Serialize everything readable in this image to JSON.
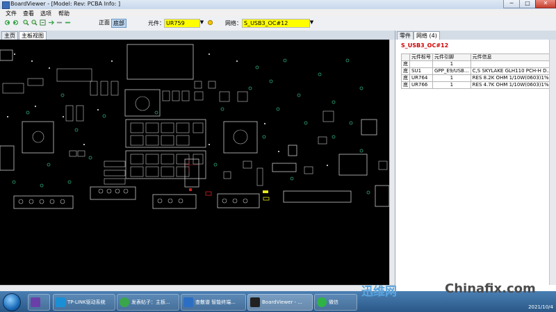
{
  "window": {
    "title": "BoardViewer  -  [Model: Rev:  PCBA Info: ]",
    "min_label": "─",
    "max_label": "□",
    "close_label": "✕"
  },
  "menu": [
    "文件",
    "查看",
    "选项",
    "帮助"
  ],
  "toolbar": {
    "view_front_label": "正面",
    "view_back_label": "底部",
    "component_label": "元件：",
    "component_value": "UR759",
    "net_label": "网络：",
    "net_value": "S_USB3_OC#12",
    "dropdown_arrow": "▼"
  },
  "left_tabs": [
    "主页",
    "主板视图"
  ],
  "right_panel": {
    "tabs": [
      "零件",
      "网络 (4)"
    ],
    "net_name": "S_USB3_OC#12",
    "columns": [
      "",
      "元件标号",
      "元件引脚",
      "元件信息"
    ],
    "rows": [
      [
        "底",
        "",
        "1",
        ""
      ],
      [
        "底",
        "SU1",
        "GPP_E9/USB...",
        "C,S SKYLAKE GLH110 PCH-H D..."
      ],
      [
        "底",
        "UR764",
        "1",
        "RES 8.2K OHM 1/10W(0603)1%..."
      ],
      [
        "底",
        "UR766",
        "1",
        "RES 4.7K OHM 1/10W(0603)1%..."
      ]
    ]
  },
  "taskbar": {
    "tasks": [
      {
        "label": "",
        "icon": "visual-studio-icon"
      },
      {
        "label": "TP-LINK驱动系统",
        "icon": "tplink-icon"
      },
      {
        "label": "发表帖子：主板...",
        "icon": "browser-icon"
      },
      {
        "label": "查散谱 智能终端...",
        "icon": "app-icon"
      },
      {
        "label": "BoardViewer - ...",
        "icon": "boardviewer-icon"
      },
      {
        "label": "微信",
        "icon": "wechat-icon"
      }
    ],
    "date": "2021/10/4"
  },
  "watermark": {
    "part1": "迅维网",
    "part2": "Chinafix.com"
  },
  "colors": {
    "highlight": "#ffff00",
    "board_bg": "#000000",
    "net_red": "#d00000",
    "pad_gray": "#c8c8c8"
  }
}
